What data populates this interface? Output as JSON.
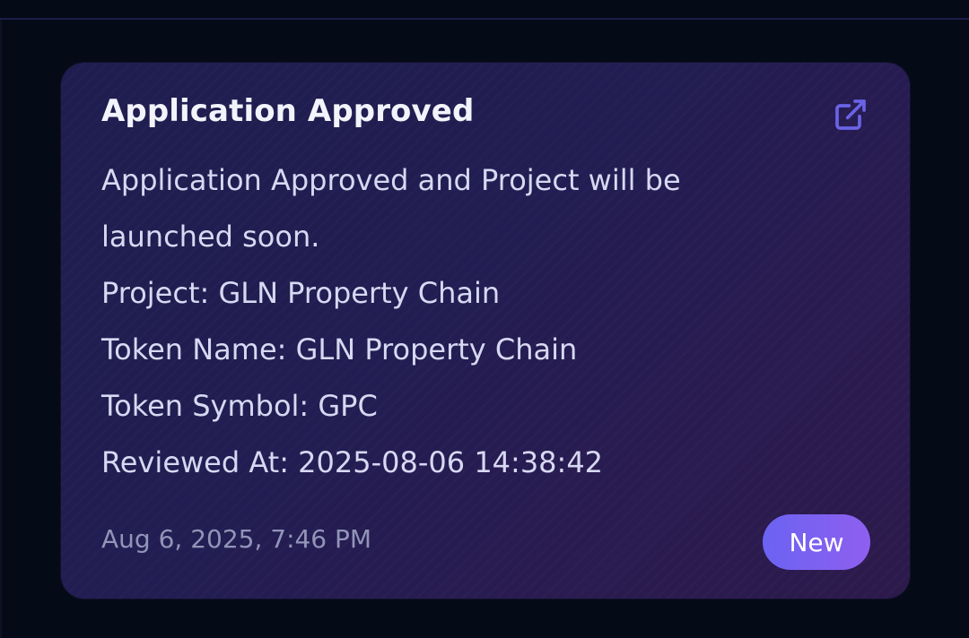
{
  "notification": {
    "title": "Application Approved",
    "message_line_1": "Application Approved and Project will be launched soon.",
    "project": "Project: GLN Property Chain",
    "token_name": "Token Name: GLN Property Chain",
    "token_symbol": "Token Symbol: GPC",
    "reviewed_at": "Reviewed At: 2025-08-06 14:38:42",
    "timestamp": "Aug 6, 2025, 7:46 PM",
    "badge": "New",
    "open_icon": "external-link-icon"
  },
  "colors": {
    "background": "#050a17",
    "card_gradient_start": "#1f1d4f",
    "card_gradient_end": "#2c1a4b",
    "icon_accent": "#6a63e6",
    "badge_gradient_start": "#6b63f2",
    "badge_gradient_end": "#8f5ff0"
  }
}
